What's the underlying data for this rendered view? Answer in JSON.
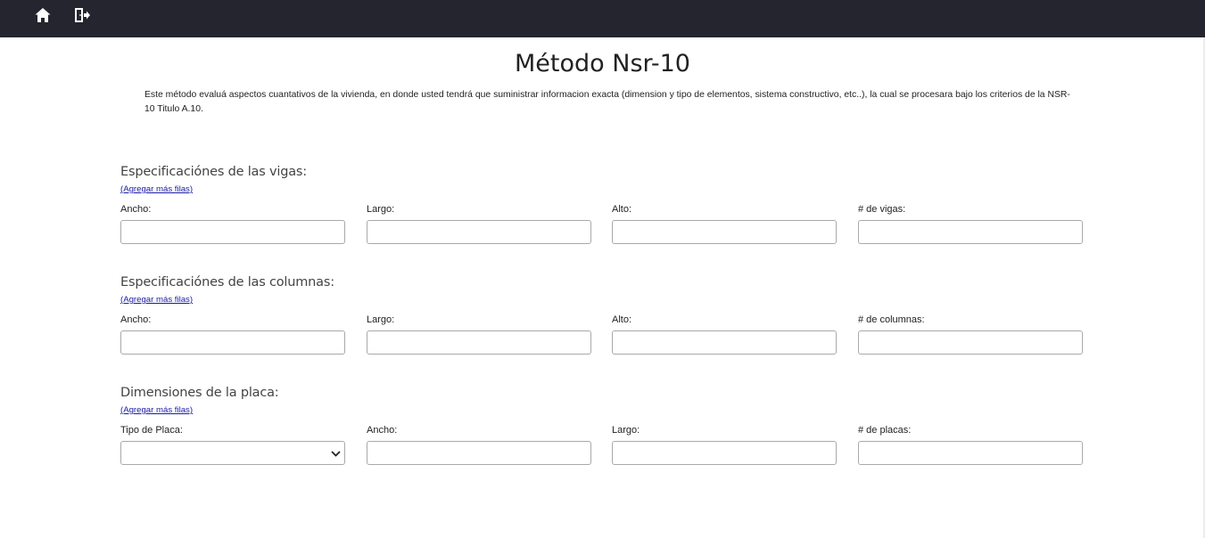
{
  "nav": {
    "items": [
      {
        "icon": "home-icon"
      },
      {
        "icon": "logout-icon"
      }
    ]
  },
  "page": {
    "title": "Método Nsr-10",
    "intro": "Este método evaluá aspectos cuantativos de la vivienda, en donde usted tendrá que suministrar informacion exacta (dimension y tipo de elementos, sistema constructivo, etc..), la cual se procesara bajo los criterios de la NSR-10 Titulo A.10."
  },
  "sections": [
    {
      "title": "Especificaciónes de las vigas:",
      "add_link": "(Agregar más filas)",
      "fields": [
        {
          "label": "Ancho:",
          "value": ""
        },
        {
          "label": "Largo:",
          "value": ""
        },
        {
          "label": "Alto:",
          "value": ""
        },
        {
          "label": "# de vigas:",
          "value": ""
        }
      ]
    },
    {
      "title": "Especificaciónes de las columnas:",
      "add_link": "(Agregar más filas)",
      "fields": [
        {
          "label": "Ancho:",
          "value": ""
        },
        {
          "label": "Largo:",
          "value": ""
        },
        {
          "label": "Alto:",
          "value": ""
        },
        {
          "label": "# de columnas:",
          "value": ""
        }
      ]
    },
    {
      "title": "Dimensiones de la placa:",
      "add_link": "(Agregar más filas)",
      "fields": [
        {
          "label": "Tipo de Placa:",
          "value": "",
          "type": "select"
        },
        {
          "label": "Ancho:",
          "value": ""
        },
        {
          "label": "Largo:",
          "value": ""
        },
        {
          "label": "# de placas:",
          "value": ""
        }
      ]
    }
  ],
  "colors": {
    "navbar": "#25252f",
    "link": "#1a1aa6"
  }
}
